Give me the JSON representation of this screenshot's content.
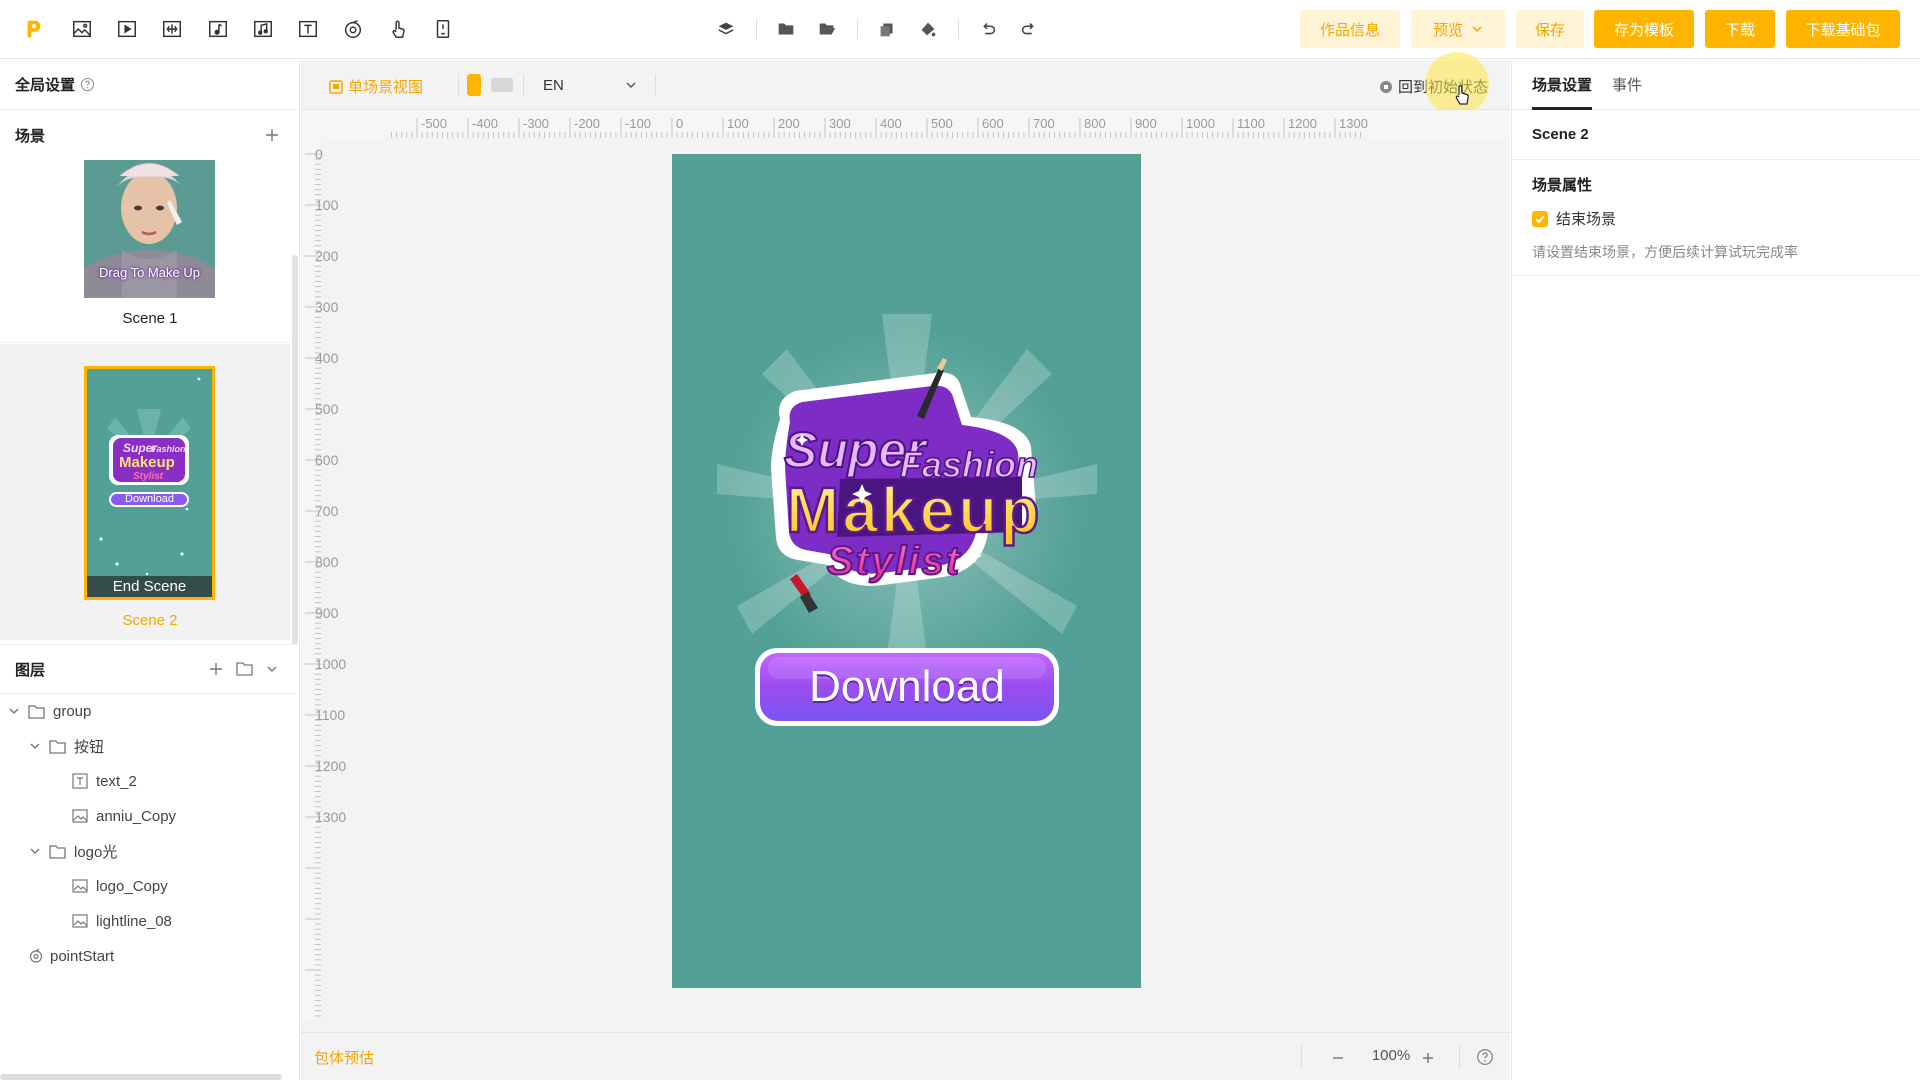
{
  "toolbar": {
    "left_tools": [
      "logo-icon",
      "image-icon",
      "video-icon",
      "add-component-icon",
      "audio-icon",
      "music-icon",
      "text-icon",
      "spin-icon",
      "touch-icon",
      "device-icon"
    ],
    "center_tools": [
      "layers-icon",
      "folder-icon",
      "open-folder-icon",
      "copy-icon",
      "paint-icon",
      "undo-icon",
      "redo-icon"
    ],
    "work_info": "作品信息",
    "preview": "预览",
    "save": "保存",
    "save_template": "存为模板",
    "download": "下载",
    "download_base": "下载基础包",
    "accent": "#ffb400",
    "accent_light": "#fff4d6"
  },
  "left_panel": {
    "global_settings": "全局设置",
    "scenes_title": "场景",
    "scenes": [
      {
        "name": "Scene 1",
        "overlay_text": "Drag To Make Up",
        "selected": false
      },
      {
        "name": "Scene 2",
        "overlay_text": "End Scene",
        "badge_text": "Download",
        "logo_words": [
          "Super",
          "Fashion",
          "Makeup",
          "Stylist"
        ],
        "selected": true
      }
    ],
    "layers_title": "图层",
    "layers": [
      {
        "name": "group",
        "type": "folder",
        "depth": 0,
        "expanded": true
      },
      {
        "name": "按钮",
        "type": "folder",
        "depth": 1,
        "expanded": true
      },
      {
        "name": "text_2",
        "type": "text",
        "depth": 2
      },
      {
        "name": "anniu_Copy",
        "type": "image",
        "depth": 2
      },
      {
        "name": "logo光",
        "type": "folder",
        "depth": 1,
        "expanded": true
      },
      {
        "name": "logo_Copy",
        "type": "image",
        "depth": 2
      },
      {
        "name": "lightline_08",
        "type": "image",
        "depth": 2
      },
      {
        "name": "pointStart",
        "type": "point",
        "depth": 0
      }
    ]
  },
  "canvas": {
    "single_scene_view": "单场景视图",
    "language": "EN",
    "reset_state": "回到初始状态",
    "ruler_h": [
      "-500",
      "-400",
      "-300",
      "-200",
      "-100",
      "0",
      "100",
      "200",
      "300",
      "400",
      "500",
      "600",
      "700",
      "800",
      "900",
      "1000",
      "1100",
      "1200",
      "1300"
    ],
    "ruler_v": [
      "0",
      "100",
      "200",
      "300",
      "400",
      "500",
      "600",
      "700",
      "800",
      "900",
      "1000",
      "1100",
      "1200",
      "1300"
    ],
    "stage_color": "#52a096",
    "logo": {
      "word1": "Super",
      "word2": "Fashion",
      "word3": "Makeup",
      "word4": "Stylist"
    },
    "download_button": "Download",
    "package_estimate": "包体预估",
    "zoom": "100%"
  },
  "right_panel": {
    "tabs": [
      "场景设置",
      "事件"
    ],
    "active_tab": 0,
    "scene_name": "Scene 2",
    "props_title": "场景属性",
    "end_scene_label": "结束场景",
    "end_scene_checked": true,
    "hint": "请设置结束场景，方便后续计算试玩完成率"
  }
}
